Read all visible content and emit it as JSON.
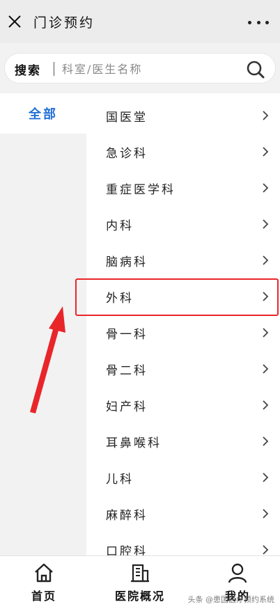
{
  "header": {
    "title": "门诊预约",
    "close_icon": "close-icon",
    "more_icon": "more-dots-icon"
  },
  "search": {
    "label": "搜索",
    "placeholder": "科室/医生名称",
    "icon": "search-icon"
  },
  "left_nav": {
    "items": [
      {
        "label": "全部",
        "active": true
      }
    ]
  },
  "departments": [
    {
      "label": "国医堂"
    },
    {
      "label": "急诊科"
    },
    {
      "label": "重症医学科"
    },
    {
      "label": "内科"
    },
    {
      "label": "脑病科"
    },
    {
      "label": "外科",
      "highlighted": true
    },
    {
      "label": "骨一科"
    },
    {
      "label": "骨二科"
    },
    {
      "label": "妇产科"
    },
    {
      "label": "耳鼻喉科"
    },
    {
      "label": "儿科"
    },
    {
      "label": "麻醉科"
    },
    {
      "label": "口腔科"
    }
  ],
  "bottom_tabs": [
    {
      "label": "首页",
      "icon": "home-icon"
    },
    {
      "label": "医院概况",
      "icon": "building-icon"
    },
    {
      "label": "我的",
      "icon": "user-icon"
    }
  ],
  "watermark": "头条 @患国医疗预约系统",
  "colors": {
    "accent": "#1f6fd6",
    "highlight": "#e8262a"
  }
}
